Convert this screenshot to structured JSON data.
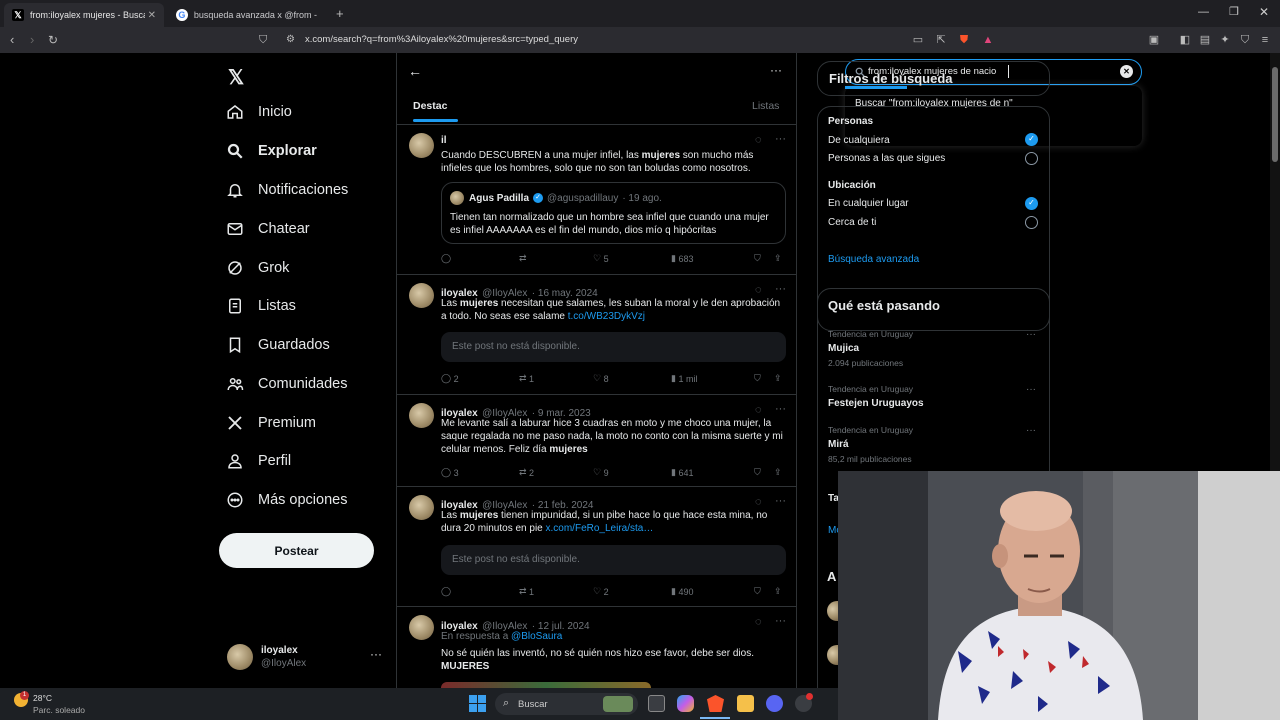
{
  "browser": {
    "tabs": [
      {
        "title": "from:iloyalex mujeres - Buscar / X",
        "favicon": "x-icon",
        "active": true
      },
      {
        "title": "busqueda avanzada x @from - Buscar",
        "favicon": "google-icon",
        "active": false
      }
    ],
    "url": "x.com/search?q=from%3Ailoyalex%20mujeres&src=typed_query"
  },
  "sidebar": {
    "items": [
      {
        "label": "Inicio",
        "icon": "home-icon"
      },
      {
        "label": "Explorar",
        "icon": "search-icon"
      },
      {
        "label": "Notificaciones",
        "icon": "bell-icon"
      },
      {
        "label": "Chatear",
        "icon": "mail-icon"
      },
      {
        "label": "Grok",
        "icon": "grok-icon"
      },
      {
        "label": "Listas",
        "icon": "list-icon"
      },
      {
        "label": "Guardados",
        "icon": "bookmark-icon"
      },
      {
        "label": "Comunidades",
        "icon": "people-icon"
      },
      {
        "label": "Premium",
        "icon": "x-icon"
      },
      {
        "label": "Perfil",
        "icon": "person-icon"
      },
      {
        "label": "Más opciones",
        "icon": "more-circle-icon"
      }
    ],
    "post_button": "Postear",
    "account": {
      "name": "iloyalex",
      "handle": "@IloyAlex"
    }
  },
  "search": {
    "value": "from:iloyalex mujeres de nacio",
    "suggestion": "Buscar \"from:iloyalex mujeres de n\""
  },
  "tabs": {
    "featured": "Destac",
    "lists": "Listas"
  },
  "tweets": [
    {
      "name": "il",
      "handle": "",
      "date": "",
      "text_pre": "Cuando DESCUBREN a una mujer infiel, las ",
      "bold": "mujeres",
      "text_post": " son mucho más infieles que los hombres, solo que no son tan boludas como nosotros.",
      "quote": {
        "name": "Agus Padilla",
        "handle": "@aguspadillauy",
        "date": "· 19 ago.",
        "text": "Tienen tan normalizado que un hombre sea infiel que cuando una mujer es infiel AAAAAAA es el fin del mundo, dios mío q hipócritas"
      },
      "replies": "",
      "reposts": "",
      "likes": "5",
      "views": "683"
    },
    {
      "name": "iloyalex",
      "handle": "@IloyAlex",
      "date": "· 16 may. 2024",
      "text_pre": "Las ",
      "bold": "mujeres",
      "text_post": " necesitan que salames, les suban la moral y le den aprobación a todo. No seas ese salame ",
      "link": "t.co/WB23DykVzj",
      "unavailable": "Este post no está disponible.",
      "replies": "2",
      "reposts": "1",
      "likes": "8",
      "views": "1 mil"
    },
    {
      "name": "iloyalex",
      "handle": "@IloyAlex",
      "date": "· 9 mar. 2023",
      "text_pre": "Me levante salí a laburar hice 3 cuadras en moto y me choco una mujer, la saque regalada no me paso nada, la moto no conto con la misma suerte y mi celular menos. Feliz día ",
      "bold": "mujeres",
      "text_post": "",
      "replies": "3",
      "reposts": "2",
      "likes": "9",
      "views": "641"
    },
    {
      "name": "iloyalex",
      "handle": "@IloyAlex",
      "date": "· 21 feb. 2024",
      "text_pre": "Las ",
      "bold": "mujeres",
      "text_post": " tienen impunidad, si un pibe hace lo que hace esta mina, no dura 20 minutos en pie ",
      "link": "x.com/FeRo_Leira/sta…",
      "unavailable": "Este post no está disponible.",
      "replies": "",
      "reposts": "1",
      "likes": "2",
      "views": "490"
    },
    {
      "name": "iloyalex",
      "handle": "@IloyAlex",
      "date": "· 12 jul. 2024",
      "reply_to_label": "En respuesta a",
      "reply_to": "@BloSaura",
      "text_pre": "No sé quién las inventó, no sé quién nos hizo ese favor, debe ser dios. ",
      "bold": "MUJERES",
      "text_post": ""
    }
  ],
  "filters": {
    "title": "Filtros de búsqueda",
    "people_title": "Personas",
    "people_options": [
      "De cualquiera",
      "Personas a las que sigues"
    ],
    "location_title": "Ubicación",
    "location_options": [
      "En cualquier lugar",
      "Cerca de ti"
    ],
    "advanced": "Búsqueda avanzada"
  },
  "trends": {
    "title": "Qué está pasando",
    "items": [
      {
        "context": "Tendencia en Uruguay",
        "name": "Mujica",
        "count": "2.094 publicaciones"
      },
      {
        "context": "Tendencia en Uruguay",
        "name": "Festejen Uruguayos",
        "count": ""
      },
      {
        "context": "Tendencia en Uruguay",
        "name": "Mirá",
        "count": "85,2 mil publicaciones"
      }
    ],
    "partial_ta": "Ta",
    "partial_mo": "Mo",
    "partial_a": "A"
  },
  "taskbar": {
    "temp": "28°C",
    "weather": "Parc. soleado",
    "search": "Buscar"
  },
  "colors": {
    "accent": "#1d9bf0",
    "bg": "#000000",
    "border": "#2f3336",
    "muted": "#71767b"
  }
}
